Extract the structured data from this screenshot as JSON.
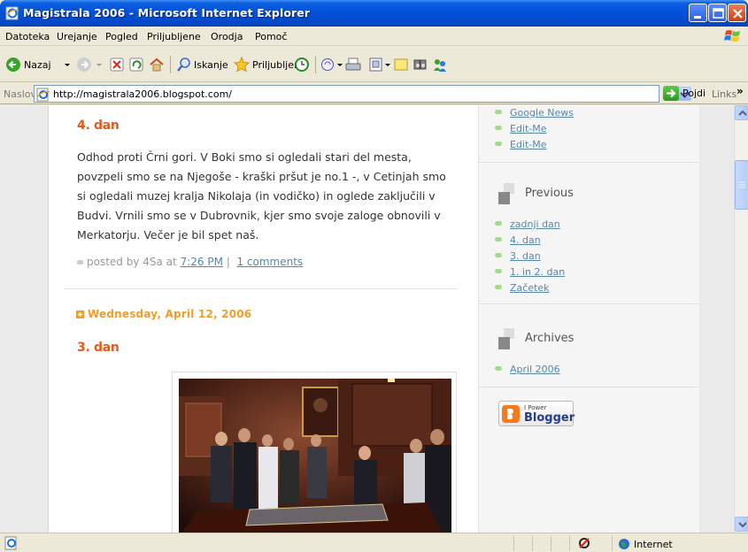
{
  "window": {
    "title": "Magistrala 2006 - Microsoft Internet Explorer"
  },
  "menu": [
    "Datoteka",
    "Urejanje",
    "Pogled",
    "Priljubljene",
    "Orodja",
    "Pomoč"
  ],
  "toolbar": {
    "back": "Nazaj",
    "search": "Iskanje",
    "favorites": "Priljubljene"
  },
  "address": {
    "label": "Naslov",
    "url": "http://magistrala2006.blogspot.com/",
    "go": "Pojdi",
    "links": "Links"
  },
  "posts": [
    {
      "title": "4. dan",
      "body": "Odhod proti Črni gori. V Boki smo si ogledali stari del mesta, povzpeli smo se na Njegoše - kraški pršut je no.1 -, v Cetinjah smo si ogledali muzej kralja Nikolaja (in vodičko) in oglede zaključili v Budvi. Vrnili smo se v Dubrovnik, kjer smo svoje zaloge obnovili v Merkatorju. Večer je bil spet naš.",
      "posted_by": "posted by 4Sa at",
      "time": "7:26 PM",
      "sep": "|",
      "comments": "1 comments"
    },
    {
      "date": "Wednesday, April 12, 2006",
      "title": "3. dan"
    }
  ],
  "sidebar": {
    "links_top": [
      "Google News",
      "Edit-Me",
      "Edit-Me"
    ],
    "previous_heading": "Previous",
    "previous": [
      "zadnji dan",
      "4. dan",
      "3. dan",
      "1. in 2. dan",
      "Začetek"
    ],
    "archives_heading": "Archives",
    "archives": [
      "April 2006"
    ],
    "badge_small": "I Power",
    "badge_big": "Blogger"
  },
  "status": {
    "zone": "Internet"
  },
  "colors": {
    "title_orange": "#e65b1a",
    "date_orange": "#ee9e2a",
    "link_blue": "#5588aa",
    "bullet_green": "#a5d88f"
  }
}
